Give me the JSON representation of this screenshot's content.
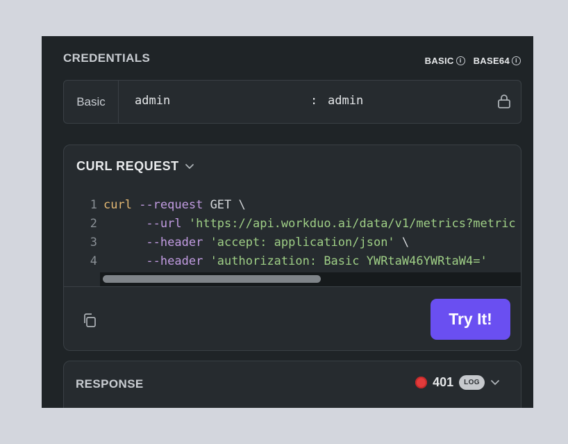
{
  "credentials": {
    "title": "CREDENTIALS",
    "links": [
      {
        "label": "BASIC",
        "icon": "info-icon"
      },
      {
        "label": "BASE64",
        "icon": "info-icon"
      }
    ],
    "type_label": "Basic",
    "username": "admin",
    "separator": ":",
    "password": "admin",
    "lock_icon": "lock-icon"
  },
  "curl": {
    "title": "CURL REQUEST",
    "lines": [
      {
        "num": "1",
        "parts": [
          {
            "t": "curl",
            "c": "kw"
          },
          {
            "t": " ",
            "c": "pl"
          },
          {
            "t": "--request",
            "c": "fl"
          },
          {
            "t": " GET \\",
            "c": "pl"
          }
        ]
      },
      {
        "num": "2",
        "parts": [
          {
            "t": "      ",
            "c": "pl"
          },
          {
            "t": "--url",
            "c": "fl"
          },
          {
            "t": " ",
            "c": "pl"
          },
          {
            "t": "'https://api.workduo.ai/data/v1/metrics?metric",
            "c": "st"
          }
        ]
      },
      {
        "num": "3",
        "parts": [
          {
            "t": "      ",
            "c": "pl"
          },
          {
            "t": "--header",
            "c": "fl"
          },
          {
            "t": " ",
            "c": "pl"
          },
          {
            "t": "'accept: application/json'",
            "c": "st"
          },
          {
            "t": " \\",
            "c": "pl"
          }
        ]
      },
      {
        "num": "4",
        "parts": [
          {
            "t": "      ",
            "c": "pl"
          },
          {
            "t": "--header",
            "c": "fl"
          },
          {
            "t": " ",
            "c": "pl"
          },
          {
            "t": "'authorization: Basic YWRtaW46YWRtaW4='",
            "c": "st"
          }
        ]
      }
    ],
    "copy_icon": "copy-icon",
    "try_label": "Try It!"
  },
  "response": {
    "title": "RESPONSE",
    "status_code": "401",
    "badge": "LOG",
    "status_color": "#e23b3b"
  },
  "colors": {
    "accent": "#6a4ff1",
    "panel_bg": "#1f2427"
  }
}
